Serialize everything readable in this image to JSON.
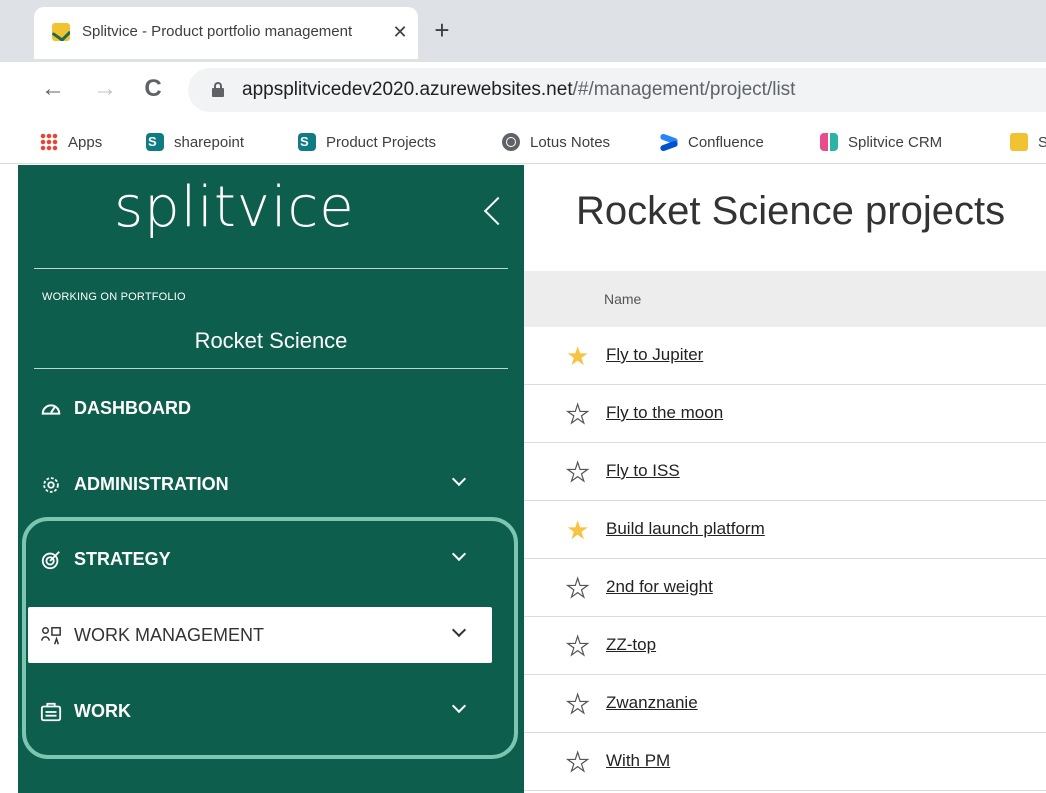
{
  "browser": {
    "tab_title": "Splitvice - Product portfolio management",
    "tab_close": "✕",
    "new_tab": "+",
    "nav": {
      "back": "←",
      "forward": "→",
      "reload": "C"
    },
    "url_host": "appsplitvicedev2020.azurewebsites.net",
    "url_path": "/#/management/project/list",
    "bookmarks": [
      {
        "label": "Apps",
        "icon": "apps-grid-icon"
      },
      {
        "label": "sharepoint",
        "icon": "sharepoint-icon"
      },
      {
        "label": "Product Projects",
        "icon": "sharepoint-icon"
      },
      {
        "label": "Lotus Notes",
        "icon": "globe-icon"
      },
      {
        "label": "Confluence",
        "icon": "confluence-icon"
      },
      {
        "label": "Splitvice CRM",
        "icon": "crm-icon"
      },
      {
        "label": "S",
        "icon": "splitvice-icon"
      }
    ]
  },
  "sidebar": {
    "logo": "splitvice",
    "portfolio_label": "WORKING ON PORTFOLIO",
    "portfolio_name": "Rocket Science",
    "items": [
      {
        "label": "DASHBOARD",
        "icon": "dashboard-gauge-icon"
      },
      {
        "label": "ADMINISTRATION",
        "icon": "gear-icon"
      },
      {
        "label": "STRATEGY",
        "icon": "target-icon"
      },
      {
        "label": "WORK MANAGEMENT",
        "icon": "people-chart-icon"
      },
      {
        "label": "WORK",
        "icon": "briefcase-icon"
      }
    ]
  },
  "main": {
    "title": "Rocket Science projects",
    "column_name": "Name",
    "projects": [
      {
        "name": "Fly to Jupiter",
        "favorite": true
      },
      {
        "name": "Fly to the moon",
        "favorite": false
      },
      {
        "name": "Fly to ISS",
        "favorite": false
      },
      {
        "name": "Build launch platform",
        "favorite": true
      },
      {
        "name": "2nd for weight",
        "favorite": false
      },
      {
        "name": "ZZ-top",
        "favorite": false
      },
      {
        "name": "Zwanznanie",
        "favorite": false
      },
      {
        "name": "With PM",
        "favorite": false
      }
    ]
  },
  "colors": {
    "sidebar_bg": "#0d5e4d",
    "highlight": "#7cc6b1",
    "star_fav": "#f6c342"
  }
}
